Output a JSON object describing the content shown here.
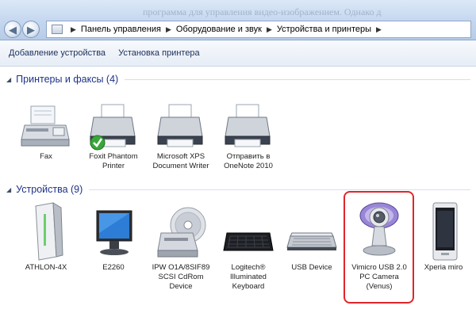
{
  "window": {
    "background_text": "программа для управления видео-изображением. Однако д",
    "breadcrumb": [
      "Панель управления",
      "Оборудование и звук",
      "Устройства и принтеры"
    ]
  },
  "toolbar": {
    "add_device": "Добавление устройства",
    "add_printer": "Установка принтера"
  },
  "groups": {
    "printers": {
      "title": "Принтеры и факсы (4)",
      "items": [
        {
          "label": "Fax",
          "icon": "fax-icon"
        },
        {
          "label": "Foxit Phantom\nPrinter",
          "icon": "printer-default-icon"
        },
        {
          "label": "Microsoft XPS\nDocument Writer",
          "icon": "printer-icon"
        },
        {
          "label": "Отправить в\nOneNote 2010",
          "icon": "printer-icon"
        }
      ]
    },
    "devices": {
      "title": "Устройства (9)",
      "items": [
        {
          "label": "ATHLON-4X",
          "icon": "computer-icon"
        },
        {
          "label": "E2260",
          "icon": "monitor-icon"
        },
        {
          "label": "IPW O1A/8SIF89\nSCSI CdRom\nDevice",
          "icon": "cdrom-icon"
        },
        {
          "label": "Logitech®\nIlluminated\nKeyboard",
          "icon": "keyboard-icon"
        },
        {
          "label": "USB Device",
          "icon": "usb-device-icon"
        },
        {
          "label": "Vimicro USB 2.0\nPC Camera\n(Venus)",
          "icon": "webcam-icon"
        },
        {
          "label": "Xperia miro",
          "icon": "phone-icon"
        }
      ]
    }
  },
  "colors": {
    "highlight": "#e0262b",
    "group_title": "#1e3287",
    "default_check": "#2f9e2f"
  }
}
